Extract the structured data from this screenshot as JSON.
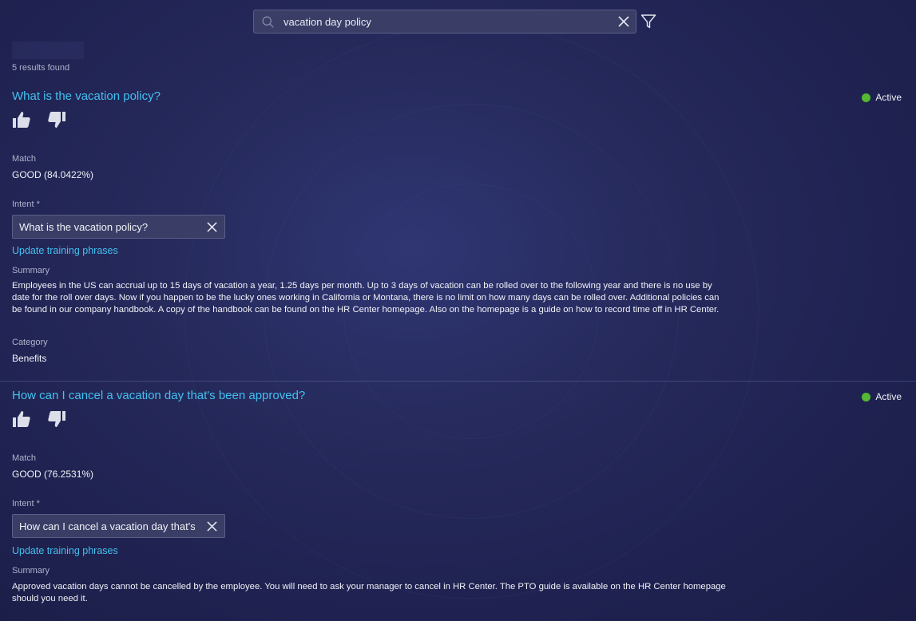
{
  "search": {
    "value": "vacation day policy",
    "placeholder": ""
  },
  "results_count": "5 results found",
  "results": [
    {
      "title": "What is the vacation policy?",
      "status": "Active",
      "match_label": "Match",
      "match_value": "GOOD (84.0422%)",
      "intent_label": "Intent *",
      "intent_value": "What is the vacation policy?",
      "update_link": "Update training phrases",
      "summary_label": "Summary",
      "summary": "Employees in the US can accrual up to 15 days of vacation a year, 1.25 days per month. Up to 3 days of vacation can be rolled over to the following year and there is no use by date for the roll over days. Now if you happen to be the lucky ones working in California or Montana, there is no limit on how many days can be rolled over. Additional policies can be found in our company handbook. A copy of the handbook can be found on the HR Center homepage. Also on the homepage is a guide on how to record time off in HR Center.",
      "category_label": "Category",
      "category": "Benefits"
    },
    {
      "title": "How can I cancel a vacation day that's been approved?",
      "status": "Active",
      "match_label": "Match",
      "match_value": "GOOD (76.2531%)",
      "intent_label": "Intent *",
      "intent_value": "How can I cancel a vacation day that's been approved?",
      "update_link": "Update training phrases",
      "summary_label": "Summary",
      "summary": "Approved vacation days cannot be cancelled by the employee. You will need to ask your manager to cancel in HR Center. The PTO guide is available on the HR Center homepage should you need it."
    }
  ],
  "colors": {
    "accent_link": "#43c0f0",
    "status_active": "#55b833",
    "background": "#262a5c"
  },
  "icons": {
    "search": "search-icon",
    "clear": "close-icon",
    "filter": "filter-icon",
    "thumbs_up": "thumbs-up-icon",
    "thumbs_down": "thumbs-down-icon"
  }
}
